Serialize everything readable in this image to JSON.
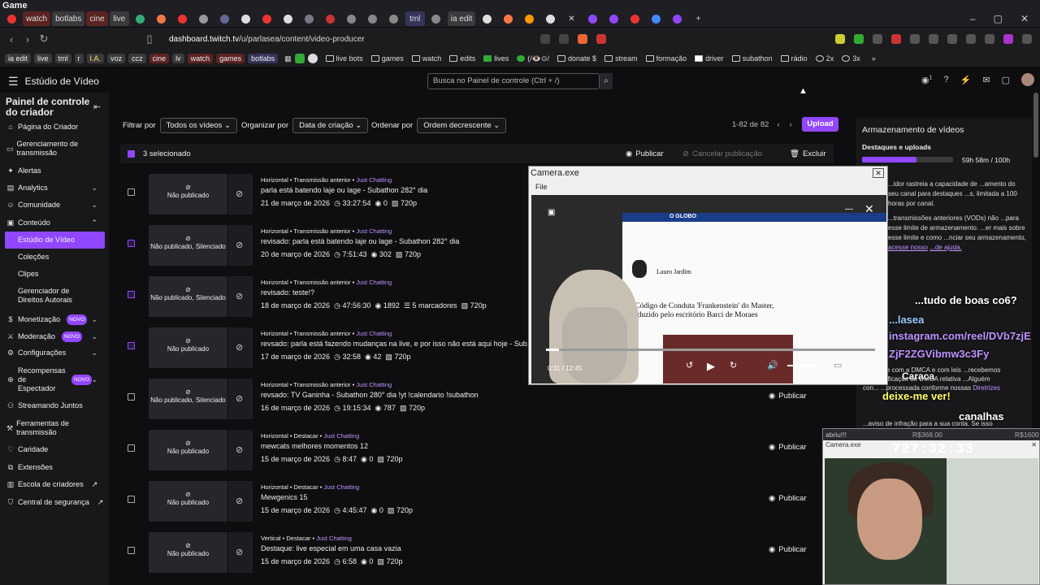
{
  "window": {
    "title": "Game"
  },
  "tabs": {
    "watch": "watch",
    "botlabs": "botlabs",
    "cine": "cine",
    "live": "live",
    "tml": "tml",
    "ia_edit": "ia edit"
  },
  "address": {
    "url_host": "dashboard.twitch.tv",
    "url_path": "/u/parlasea/content/video-producer"
  },
  "bookmarks": {
    "pills": [
      "ia edit",
      "live",
      "tml",
      "r",
      "I.A.",
      "voz",
      "ccz",
      "cine",
      "lv",
      "watch",
      "games",
      "botlabs"
    ],
    "folders": [
      "live bots",
      "games",
      "watch",
      "edits",
      "lives",
      "(/👁️⊙/",
      "donate $",
      "stream",
      "formação",
      "driver",
      "subathon",
      "rádio",
      "2x",
      "3x"
    ]
  },
  "header": {
    "studio": "Estúdio de Vídeo",
    "search_placeholder": "Busca no Painel de controle (Ctrl + /)",
    "notif": "1"
  },
  "sidebar": {
    "title": "Painel de controle do criador",
    "items": [
      "Página do Criador",
      "Gerenciamento de transmissão",
      "Alertas",
      "Analytics",
      "Comunidade",
      "Conteúdo",
      "Estúdio de Vídeo",
      "Coleções",
      "Clipes",
      "Gerenciador de Direitos Autorais",
      "Monetização",
      "Moderação",
      "Configurações",
      "Recompensas de Espectador",
      "Streamando Juntos",
      "Ferramentas de transmissão",
      "Caridade",
      "Extensões",
      "Escola de criadores",
      "Central de segurança"
    ],
    "novo": "NOVO"
  },
  "filters": {
    "filter_label": "Filtrar por",
    "filter_value": "Todos os vídeos",
    "org_label": "Organizar por",
    "org_value": "Data de criação",
    "order_label": "Ordenar por",
    "order_value": "Ordem decrescente",
    "pager": "1-82 de 82",
    "upload": "Upload"
  },
  "selection": {
    "count": "3 selecionado",
    "publish": "Publicar",
    "cancel": "Cancelar publicação",
    "delete": "Excluir"
  },
  "videos": [
    {
      "meta": "Horizontal • Transmissão anterior • ",
      "cat": "Just Chatting",
      "title": "parla está batendo laje ou lage - Subathon 282° dia",
      "date": "21 de março de 2026",
      "dur": "33:27:54",
      "views": "0",
      "res": "720p",
      "status": "Não publicado",
      "checked": false
    },
    {
      "meta": "Horizontal • Transmissão anterior • ",
      "cat": "Just Chatting",
      "title": "revisado: parla está batendo laje ou lage - Subathon 282° dia",
      "date": "20 de março de 2026",
      "dur": "7:51:43",
      "views": "302",
      "res": "720p",
      "status": "Não publicado, Silenciado",
      "checked": true
    },
    {
      "meta": "Horizontal • Transmissão anterior • ",
      "cat": "Just Chatting",
      "title": "revisado: teste!?",
      "date": "18 de março de 2026",
      "dur": "47:56:30",
      "views": "1892",
      "markers": "5 marcadores",
      "res": "720p",
      "status": "Não publicado, Silenciado",
      "checked": true
    },
    {
      "meta": "Horizontal • Transmissão anterior • ",
      "cat": "Just Chatting",
      "title": "revsado: parla está fazendo mudanças na live, e por isso não está aqui hoje - Sub",
      "date": "17 de março de 2026",
      "dur": "32:58",
      "views": "42",
      "res": "720p",
      "status": "Não publicado",
      "checked": true
    },
    {
      "meta": "Horizontal • Transmissão anterior • ",
      "cat": "Just Chatting",
      "title": "revsado: TV Ganinha - Subathon 280° dia !yt !calendario !subathon",
      "date": "16 de março de 2026",
      "dur": "19:15:34",
      "views": "787",
      "res": "720p",
      "status": "Não publicado, Silenciado",
      "checked": false
    },
    {
      "meta": "Horizontal • Destacar • ",
      "cat": "Just Chatting",
      "title": "mewcats melhores momentos 12",
      "date": "15 de março de 2026",
      "dur": "8:47",
      "views": "0",
      "res": "720p",
      "status": "Não publicado",
      "checked": false
    },
    {
      "meta": "Horizontal • Destacar • ",
      "cat": "Just Chatting",
      "title": "Mewgenics 15",
      "date": "15 de março de 2026",
      "dur": "4:45:47",
      "views": "0",
      "res": "720p",
      "status": "Não publicado",
      "checked": false
    },
    {
      "meta": "Vertical • Destacar • ",
      "cat": "Just Chatting",
      "title": "Destaque: live especial em uma casa vazia",
      "date": "15 de março de 2026",
      "dur": "6:58",
      "views": "0",
      "res": "720p",
      "status": "Não publicado",
      "checked": false
    }
  ],
  "publish_label": "Publicar",
  "storage": {
    "title": "Armazenamento de vídeos",
    "sub": "Destaques e uploads",
    "usage": "59h 58m / 100h",
    "usage_fraction": 0.6,
    "text1": "...idor rastreia a capacidade de ...amento do seu canal para destaques ...s, limitada a 100 horas por canal.",
    "text2": "...transmissões anteriores (VODs) não ...para esse limite de armazenamento. ...er mais sobre esse limite e como ...nciar seu armazenamento,",
    "link1": "acesse nosso",
    "link2": "...de ajuda."
  },
  "camera1": {
    "title": "Camera.exe",
    "menu": "File",
    "news": "O GLOBO",
    "author": "Lauro Jardim",
    "headline": "O Código de Conduta 'Frankenstein' do Master, produzido pelo escritório Barci de Moraes",
    "time": "0:31 / 12:45",
    "progress": 0.04
  },
  "camera2": {
    "top": "abriu!!!",
    "r1": "R$368.00",
    "r2": "R$1600",
    "title": "Camera.exe",
    "timer": "727:32:33"
  },
  "overlay": {
    "a": "...tudo de boas co6?",
    "b": "...lasea",
    "c": "instagram.com/reel/DVb7zjE",
    "d": "ZjF2ZGVibmw3c3Fy",
    "e": "Caraca",
    "f": "deixe-me ver!",
    "g": "canalhas",
    "h": "...cumpre com a DMCA e com leis ...recebemos uma notificação de DMCA relativa ...Alguém con... ...processada conforme nossas",
    "i": "Diretrizes",
    "j": "...aviso de infração para a sua conta. Se isso"
  }
}
